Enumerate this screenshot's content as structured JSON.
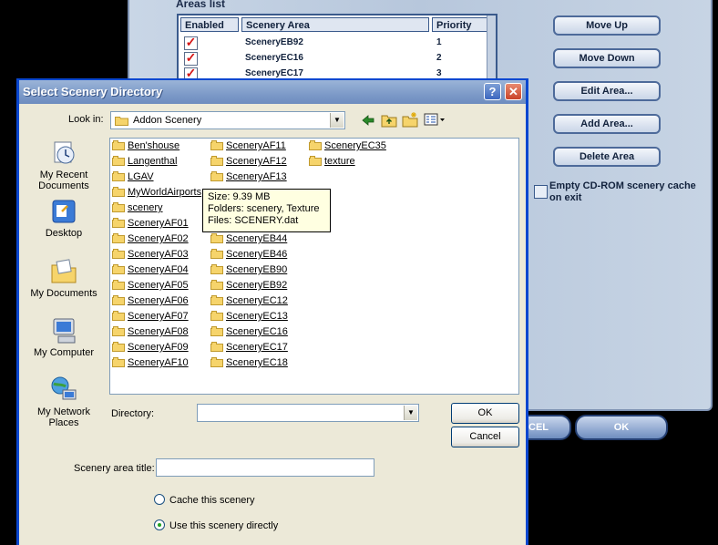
{
  "background_window": {
    "areas_title": "Areas list",
    "columns": [
      "Enabled",
      "Scenery Area",
      "Priority"
    ],
    "rows": [
      {
        "enabled": true,
        "area": "SceneryEB92",
        "priority": "1"
      },
      {
        "enabled": true,
        "area": "SceneryEC16",
        "priority": "2"
      },
      {
        "enabled": true,
        "area": "SceneryEC17",
        "priority": "3"
      }
    ],
    "buttons": {
      "move_up": "Move Up",
      "move_down": "Move Down",
      "edit_area": "Edit Area...",
      "add_area": "Add Area...",
      "delete_area": "Delete Area"
    },
    "empty_cache_label": "Empty CD-ROM scenery cache on exit",
    "cancel_label": "CEL",
    "ok_label": "OK"
  },
  "dialog": {
    "title": "Select Scenery Directory",
    "help_glyph": "?",
    "close_glyph": "✕",
    "look_in_label": "Look in:",
    "look_in_value": "Addon Scenery",
    "places": [
      {
        "label": "My Recent Documents",
        "icon": "recent-documents-icon"
      },
      {
        "label": "Desktop",
        "icon": "desktop-icon"
      },
      {
        "label": "My Documents",
        "icon": "my-documents-icon"
      },
      {
        "label": "My Computer",
        "icon": "my-computer-icon"
      },
      {
        "label": "My Network Places",
        "icon": "network-places-icon"
      }
    ],
    "folders_col1": [
      "Ben'shouse",
      "Langenthal",
      "LGAV",
      "MyWorldAirports",
      "scenery",
      "SceneryAF01",
      "SceneryAF02",
      "SceneryAF03",
      "SceneryAF04",
      "SceneryAF05",
      "SceneryAF06",
      "SceneryAF07",
      "SceneryAF08",
      "SceneryAF09",
      "SceneryAF10"
    ],
    "folders_col2": [
      "SceneryAF11",
      "SceneryAF12",
      "SceneryAF13",
      "",
      "",
      "",
      "SceneryEB44",
      "SceneryEB46",
      "SceneryEB90",
      "SceneryEB92",
      "SceneryEC12",
      "SceneryEC13",
      "SceneryEC16",
      "SceneryEC17",
      "SceneryEC18"
    ],
    "folders_col3": [
      "SceneryEC35",
      "texture"
    ],
    "tooltip": {
      "size": "Size: 9.39 MB",
      "folders": "Folders: scenery, Texture",
      "files": "Files: SCENERY.dat"
    },
    "directory_label": "Directory:",
    "directory_value": "",
    "ok_label": "OK",
    "cancel_label": "Cancel",
    "area_title_label": "Scenery area title:",
    "area_title_value": "",
    "radio_cache": "Cache this scenery",
    "radio_direct": "Use this scenery directly",
    "selected_option": "direct"
  },
  "colors": {
    "dialog_border": "#0a47d0",
    "titlebar": "#7d9ac8",
    "tooltip_bg": "#ffffe1",
    "check_mark": "#d51515"
  }
}
